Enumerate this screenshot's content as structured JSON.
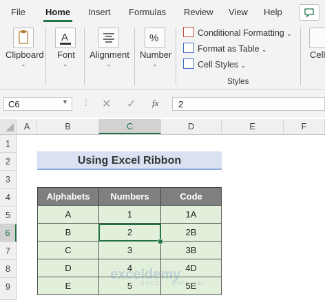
{
  "menu": {
    "file": "File",
    "home": "Home",
    "insert": "Insert",
    "formulas": "Formulas",
    "review": "Review",
    "view": "View",
    "help": "Help"
  },
  "ribbon": {
    "clipboard": "Clipboard",
    "font": "Font",
    "alignment": "Alignment",
    "number": "Number",
    "conditional_formatting": "Conditional Formatting",
    "format_as_table": "Format as Table",
    "cell_styles": "Cell Styles",
    "styles": "Styles",
    "cells": "Cells"
  },
  "formula_bar": {
    "name_box": "C6",
    "fx": "fx",
    "value": "2"
  },
  "columns": [
    "A",
    "B",
    "C",
    "D",
    "E",
    "F"
  ],
  "rows": [
    "1",
    "2",
    "3",
    "4",
    "5",
    "6",
    "7",
    "8",
    "9"
  ],
  "sheet": {
    "title": "Using Excel Ribbon",
    "headers": [
      "Alphabets",
      "Numbers",
      "Code"
    ],
    "data": [
      [
        "A",
        "1",
        "1A"
      ],
      [
        "B",
        "2",
        "2B"
      ],
      [
        "C",
        "3",
        "3B"
      ],
      [
        "D",
        "4",
        "4D"
      ],
      [
        "E",
        "5",
        "5E"
      ]
    ]
  },
  "watermark": {
    "name": "exceldemy",
    "tagline": "EXCEL · DATA · BI"
  },
  "colors": {
    "accent": "#217346",
    "header_fill": "#7f7f7f",
    "data_fill": "#e2efda",
    "title_fill": "#d9e1f2"
  }
}
